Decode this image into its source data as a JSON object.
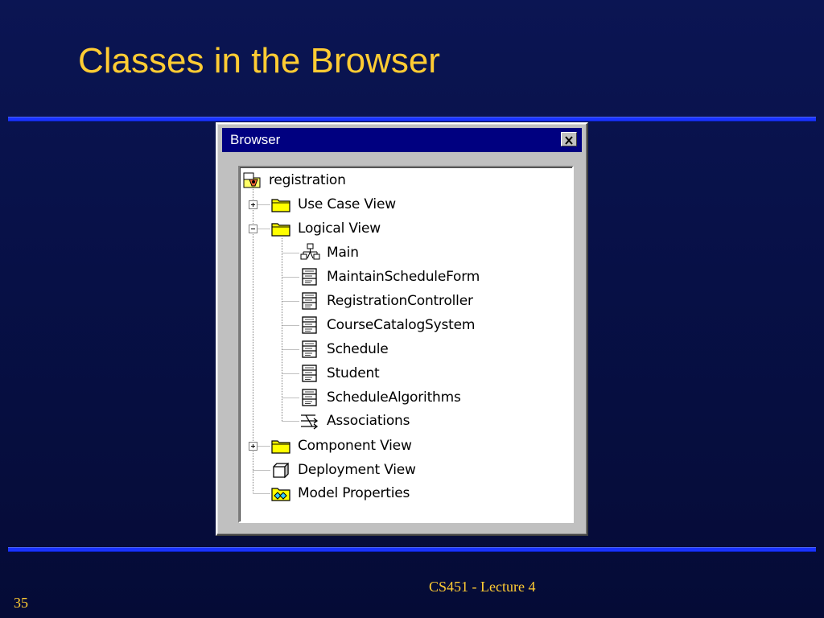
{
  "slide": {
    "title": "Classes in the Browser",
    "footer": "CS451 - Lecture 4",
    "page_number": "35",
    "colors": {
      "background": "#071046",
      "title": "#ffcc33",
      "rule": "#1a33ff"
    }
  },
  "window": {
    "title": "Browser",
    "close_icon": "close-icon",
    "titlebar_color": "#000080",
    "tree": {
      "root": {
        "label": "registration",
        "icon": "model-root-icon"
      },
      "use_case_view": {
        "label": "Use Case View",
        "icon": "folder-icon",
        "expanded": false
      },
      "logical_view": {
        "label": "Logical View",
        "icon": "folder-icon",
        "expanded": true
      },
      "logical_children": [
        {
          "label": "Main",
          "icon": "class-diagram-icon"
        },
        {
          "label": "MaintainScheduleForm",
          "icon": "class-icon"
        },
        {
          "label": "RegistrationController",
          "icon": "class-icon"
        },
        {
          "label": "CourseCatalogSystem",
          "icon": "class-icon"
        },
        {
          "label": "Schedule",
          "icon": "class-icon"
        },
        {
          "label": "Student",
          "icon": "class-icon"
        },
        {
          "label": "ScheduleAlgorithms",
          "icon": "class-icon"
        },
        {
          "label": "Associations",
          "icon": "associations-icon"
        }
      ],
      "component_view": {
        "label": "Component View",
        "icon": "folder-icon",
        "expanded": false
      },
      "deployment_view": {
        "label": "Deployment View",
        "icon": "deployment-icon"
      },
      "model_properties": {
        "label": "Model Properties",
        "icon": "model-properties-icon"
      }
    }
  }
}
